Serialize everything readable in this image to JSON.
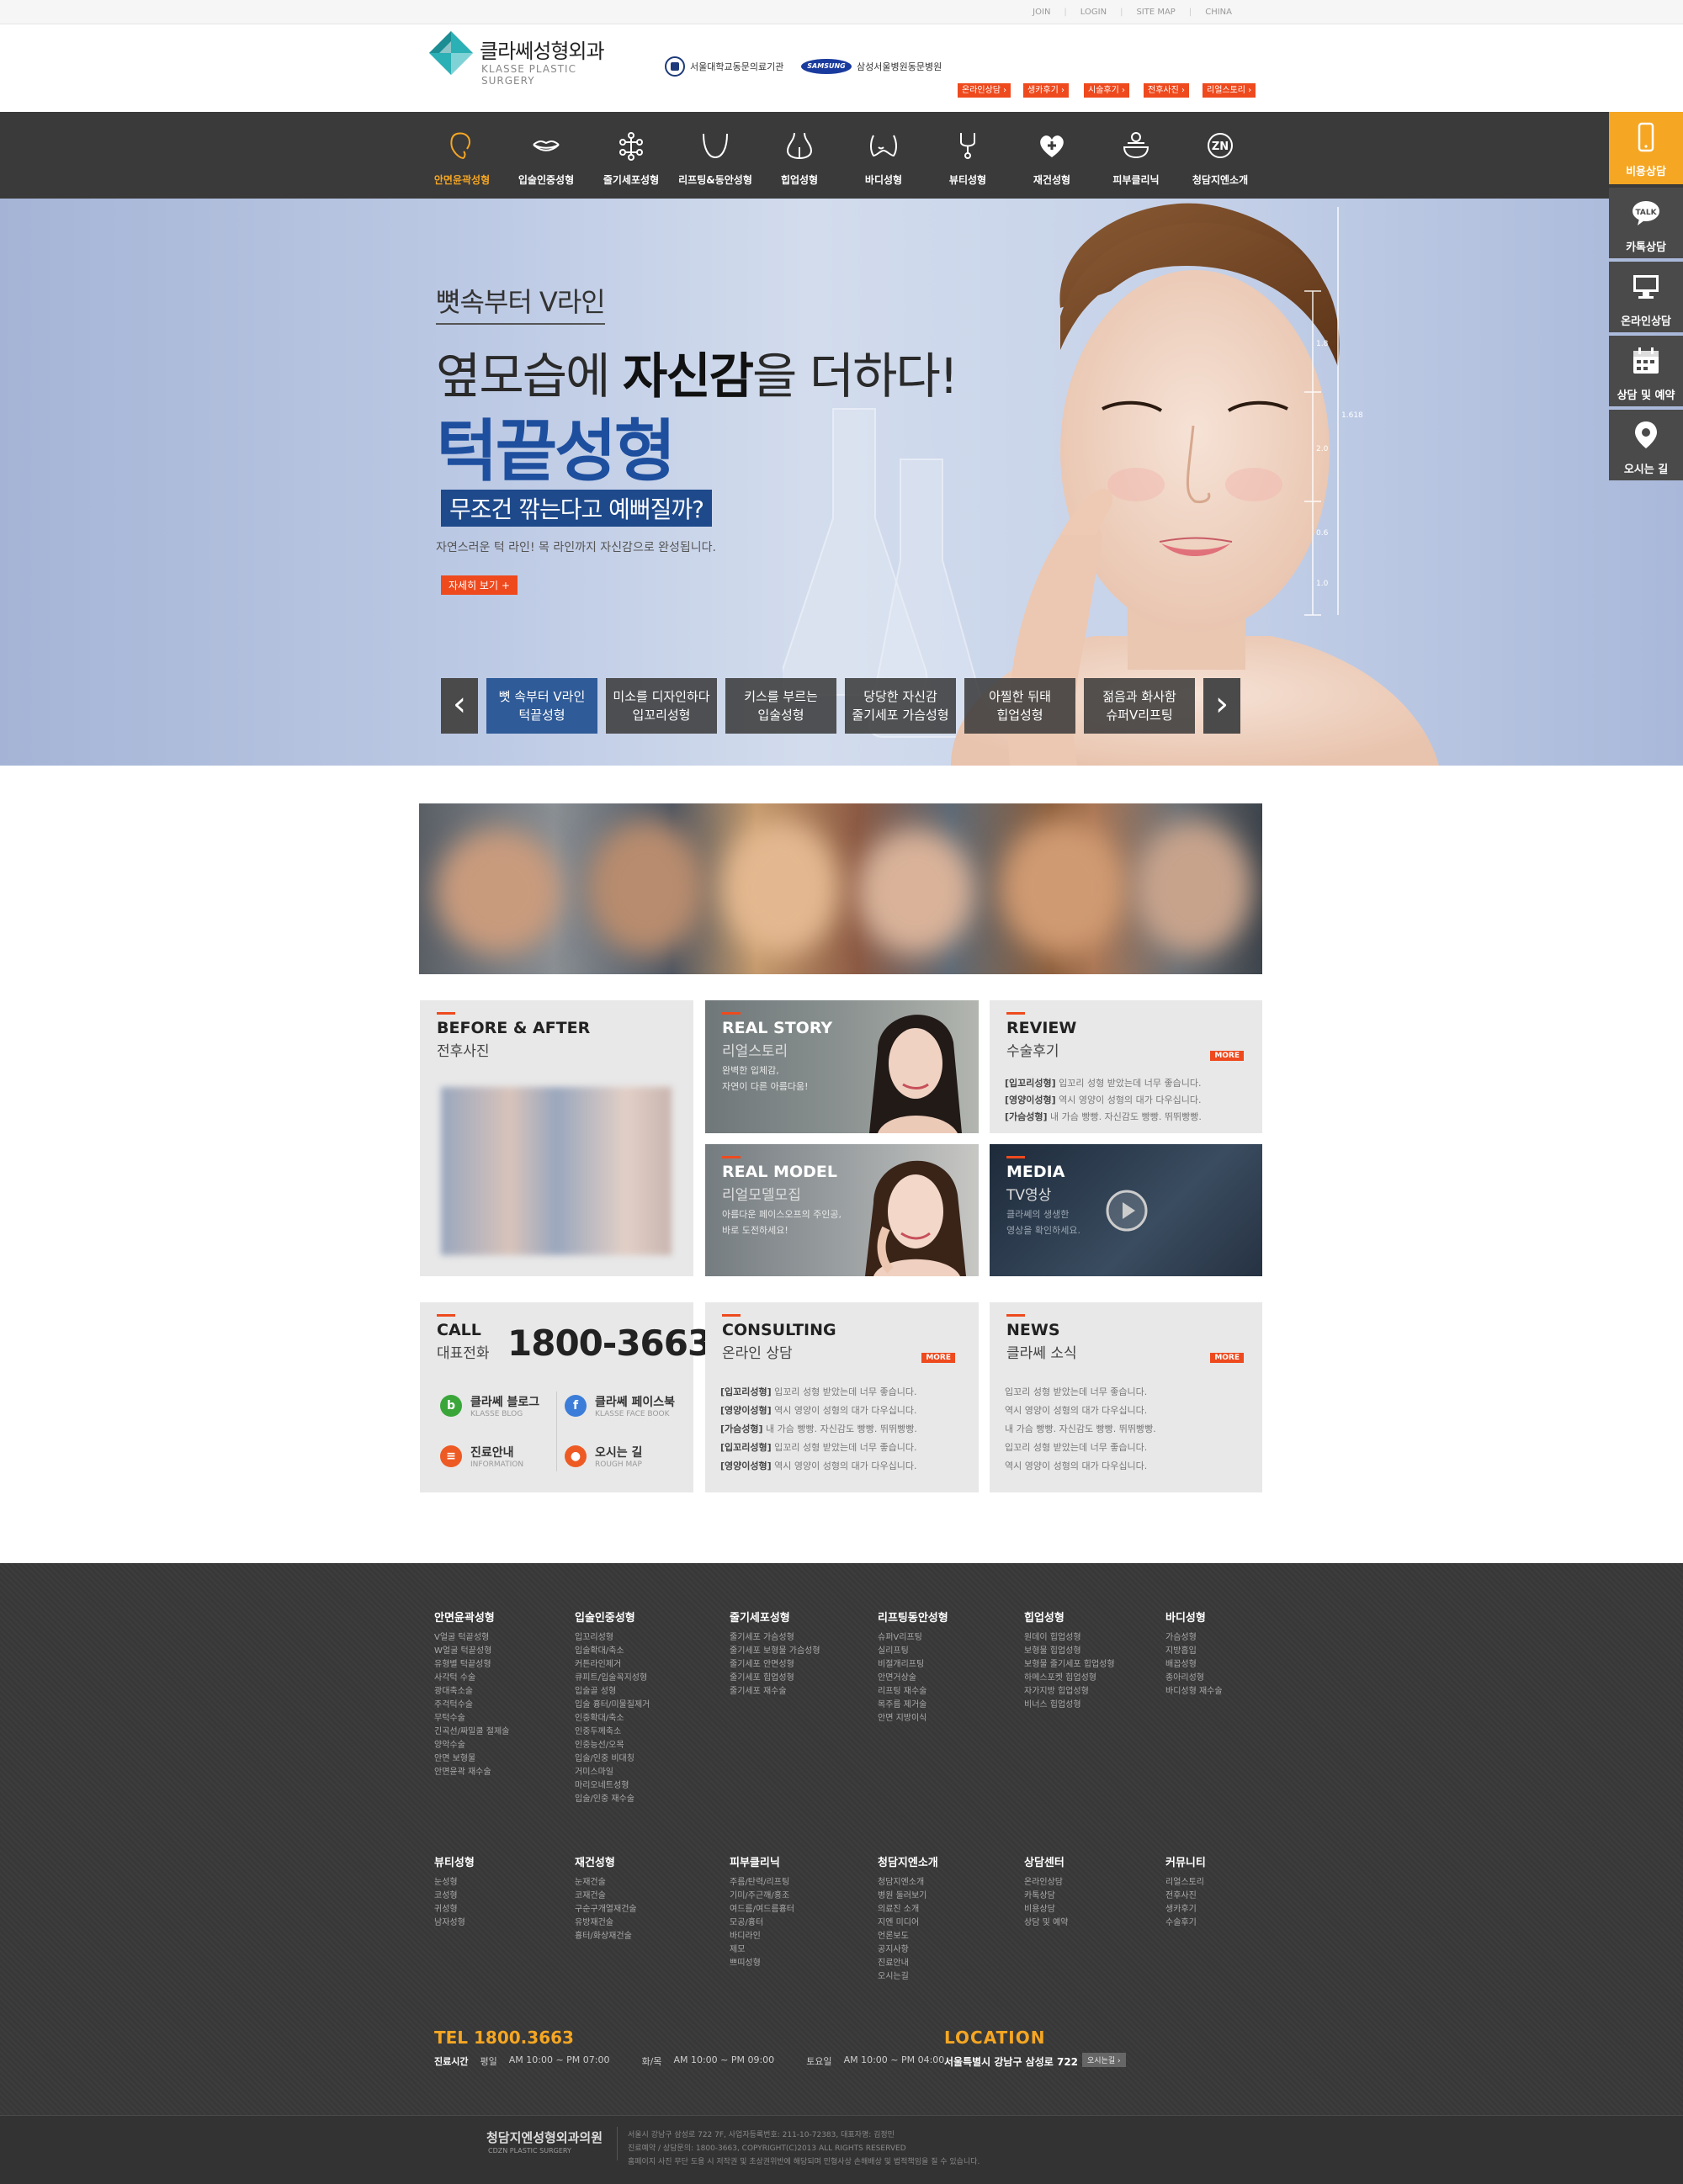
{
  "util": {
    "links": [
      "JOIN",
      "LOGIN",
      "SITE MAP",
      "CHINA"
    ]
  },
  "header": {
    "logo_ko": "클라쎄성형외과",
    "logo_en": "KLASSE PLASTIC SURGERY",
    "affil1": "서울대학교동문의료기관",
    "affil2_logo": "SAMSUNG",
    "affil2": "삼성서울병원동문병원",
    "buttons": [
      "온라인상담 ›",
      "생카후기 ›",
      "시술후기 ›",
      "전후사진 ›",
      "리얼스토리 ›"
    ]
  },
  "nav": [
    {
      "label": "안면윤곽성형",
      "icon": "face-contour-icon",
      "active": true
    },
    {
      "label": "입술인중성형",
      "icon": "lips-icon"
    },
    {
      "label": "줄기세포성형",
      "icon": "stem-cell-icon"
    },
    {
      "label": "리프팅&동안성형",
      "icon": "lifting-icon"
    },
    {
      "label": "힙업성형",
      "icon": "hip-icon"
    },
    {
      "label": "바디성형",
      "icon": "body-icon"
    },
    {
      "label": "뷰티성형",
      "icon": "beauty-icon"
    },
    {
      "label": "재건성형",
      "icon": "reconstruction-icon"
    },
    {
      "label": "피부클리닉",
      "icon": "skin-clinic-icon"
    },
    {
      "label": "청담지엔소개",
      "icon": "zn-icon"
    }
  ],
  "quick": [
    {
      "label": "비용상담",
      "icon": "phone-icon"
    },
    {
      "label": "카톡상담",
      "icon": "talk-icon"
    },
    {
      "label": "온라인상담",
      "icon": "monitor-icon"
    },
    {
      "label": "상담 및 예약",
      "icon": "calendar-icon"
    },
    {
      "label": "오시는 길",
      "icon": "map-pin-icon"
    }
  ],
  "hero": {
    "sub": "뼛속부터 V라인",
    "main_pre": "옆모습에 ",
    "main_bold": "자신감",
    "main_post": "을 더하다!",
    "title": "턱끝성형",
    "tag": "무조건 깎는다고 예뻐질까?",
    "desc": "자연스러운 턱 라인! 목 라인까지 자신감으로 완성됩니다.",
    "btn": "자세히 보기 +",
    "prev": "‹",
    "next": "›",
    "thumbs": [
      {
        "l1": "뼛 속부터 V라인",
        "l2": "턱끝성형"
      },
      {
        "l1": "미소를 디자인하다",
        "l2": "입꼬리성형"
      },
      {
        "l1": "키스를 부르는",
        "l2": "입술성형"
      },
      {
        "l1": "당당한 자신감",
        "l2": "줄기세포 가슴성형"
      },
      {
        "l1": "아찔한 뒤태",
        "l2": "힙업성형"
      },
      {
        "l1": "젊음과 화사함",
        "l2": "슈퍼V리프팅"
      }
    ],
    "ruler": [
      "1.8",
      "1.618",
      "2.0",
      "0.6",
      "1.0"
    ]
  },
  "boxes": {
    "before": {
      "t": "BEFORE & AFTER",
      "k": "전후사진"
    },
    "real": {
      "t": "REAL STORY",
      "k": "리얼스토리",
      "d1": "완벽한 입체감,",
      "d2": "자연이 다른 아름다움!"
    },
    "review": {
      "t": "REVIEW",
      "k": "수술후기",
      "more": "MORE",
      "rows": [
        {
          "tag": "[입꼬리성형]",
          "txt": " 입꼬리 성형 받았는데 너무 좋습니다."
        },
        {
          "tag": "[영양이성형]",
          "txt": " 역시 영양이 성형의 대가 다우십니다."
        },
        {
          "tag": "[가슴성형]",
          "txt": " 내 가슴 빵빵. 자신감도 빵빵. 뛰뛰빵빵."
        }
      ]
    },
    "model": {
      "t": "REAL MODEL",
      "k": "리얼모델모집",
      "d1": "아름다운 페이스오프의 주인공,",
      "d2": "바로 도전하세요!"
    },
    "media": {
      "t": "MEDIA",
      "k": "TV영상",
      "d1": "클라쎄의 생생한",
      "d2": "영상을 확인하세요."
    },
    "call": {
      "t": "CALL",
      "k": "대표전화",
      "tel": "1800-3663",
      "items": [
        {
          "t1": "클라쎄 블로그",
          "t2": "KLASSE BLOG",
          "ic": "b",
          "color": "#3aa63a",
          "icon": "blog-icon"
        },
        {
          "t1": "클라쎄 페이스북",
          "t2": "KLASSE FACE BOOK",
          "ic": "f",
          "color": "#3b7dd8",
          "icon": "facebook-icon"
        },
        {
          "t1": "진료안내",
          "t2": "INFORMATION",
          "ic": "≡",
          "color": "#ee5a24",
          "icon": "info-icon"
        },
        {
          "t1": "오시는 길",
          "t2": "ROUGH MAP",
          "ic": "●",
          "color": "#ee5a24",
          "icon": "map-icon"
        }
      ]
    },
    "consult": {
      "t": "CONSULTING",
      "k": "온라인 상담",
      "more": "MORE",
      "rows": [
        {
          "tag": "[입꼬리성형]",
          "txt": " 입꼬리 성형 받았는데 너무 좋습니다."
        },
        {
          "tag": "[영양이성형]",
          "txt": " 역시 영양이 성형의 대가 다우십니다."
        },
        {
          "tag": "[가슴성형]",
          "txt": " 내 가슴 빵빵. 자신감도 빵빵. 뛰뛰빵빵."
        },
        {
          "tag": "[입꼬리성형]",
          "txt": " 입꼬리 성형 받았는데 너무 좋습니다."
        },
        {
          "tag": "[영양이성형]",
          "txt": " 역시 영양이 성형의 대가 다우십니다."
        }
      ]
    },
    "news": {
      "t": "NEWS",
      "k": "클라쎄 소식",
      "more": "MORE",
      "rows": [
        "입꼬리 성형 받았는데 너무 좋습니다.",
        "역시 영양이 성형의 대가 다우십니다.",
        "내 가슴 빵빵. 자신감도 빵빵. 뛰뛰빵빵.",
        "입꼬리 성형 받았는데 너무 좋습니다.",
        "역시 영양이 성형의 대가 다우십니다."
      ]
    }
  },
  "footer": {
    "cols1": [
      {
        "h": "안면윤곽성형",
        "items": [
          "V얼굴 턱끝성형",
          "W얼굴 턱끝성형",
          "유형별 턱끝성형",
          "사각턱 수술",
          "광대축소술",
          "주걱턱수술",
          "무턱수술",
          "긴곡선/짜밀쿨 절제술",
          "양악수술",
          "안면 보형물",
          "안면윤곽 재수술"
        ]
      },
      {
        "h": "입술인중성형",
        "items": [
          "입꼬리성형",
          "입술확대/축소",
          "커튼라인제거",
          "큐피트/입술꼭지성형",
          "입술골 성형",
          "입술 흉터/미물질제거",
          "인중확대/축소",
          "인중두께축소",
          "인중능선/오목",
          "입술/인중 비대칭",
          "거미스마일",
          "마리오네트성형",
          "입술/인중 재수술"
        ]
      },
      {
        "h": "줄기세포성형",
        "items": [
          "줄기세포 가슴성형",
          "줄기세포 보형물 가슴성형",
          "줄기세포 안면성형",
          "줄기세포 힙업성형",
          "줄기세포 재수술"
        ]
      },
      {
        "h": "리프팅동안성형",
        "items": [
          "슈퍼V리프팅",
          "실리프팅",
          "비절개리프팅",
          "안면거상술",
          "리프팅 재수술",
          "목주름 제거술",
          "안면 지방이식"
        ]
      },
      {
        "h": "힙업성형",
        "items": [
          "원데이 힙업성형",
          "보형물 힙업성형",
          "보형물 줄기세포 힙업성형",
          "하메스포켓 힙업성형",
          "자가지방 힙업성형",
          "비너스 힙업성형"
        ]
      },
      {
        "h": "바디성형",
        "items": [
          "가슴성형",
          "지방흡입",
          "배꼽성형",
          "종아리성형",
          "바디성형 재수술"
        ]
      }
    ],
    "cols2": [
      {
        "h": "뷰티성형",
        "items": [
          "눈성형",
          "코성형",
          "귀성형",
          "남자성형"
        ]
      },
      {
        "h": "재건성형",
        "items": [
          "눈재건술",
          "코재건술",
          "구순구개열재건술",
          "유방재건술",
          "흉터/화상재건술"
        ]
      },
      {
        "h": "피부클리닉",
        "items": [
          "주름/탄력/리프팅",
          "기미/주근깨/홍조",
          "여드름/여드름흉터",
          "모공/흉터",
          "바디라인",
          "제모",
          "쁘띠성형"
        ]
      },
      {
        "h": "청담지엔소개",
        "items": [
          "청담지엔소개",
          "병원 둘러보기",
          "의료진 소개",
          "지엔 미디어",
          "언론보도",
          "공지사항",
          "진료안내",
          "오시는길"
        ]
      },
      {
        "h": "상담센터",
        "items": [
          "온라인상담",
          "카톡상담",
          "비용상담",
          "상담 및 예약"
        ]
      },
      {
        "h": "커뮤니티",
        "items": [
          "리얼스토리",
          "전후사진",
          "생카후기",
          "수술후기"
        ]
      }
    ],
    "tel": "TEL 1800.3663",
    "location": "LOCATION",
    "hours_label": "진료시간",
    "hours": [
      {
        "d": "평일",
        "t": "AM 10:00 ~ PM 07:00"
      },
      {
        "d": "화/목",
        "t": "AM 10:00 ~ PM 09:00"
      },
      {
        "d": "토요일",
        "t": "AM 10:00 ~ PM 04:00"
      }
    ],
    "address": "서울특별시 강남구 삼성로 722 7F",
    "map_btn": "오시는길 ›",
    "brand": "청담지엔성형외과의원",
    "brand_en": "CDZN PLASTIC SURGERY",
    "copy1": "서울시 강남구 삼성로 722 7F, 사업자등록번호: 211-10-72383, 대표자명: 김정민",
    "copy2": "진료예약 / 상담문의: 1800-3663, COPYRIGHT(C)2013 ALL RIGHTS RESERVED",
    "copy3": "홈페이지 사진 무단 도용 시 저작권 및 초상권위반에 해당되며 민형사상 손해배상 및 법적책임을 질 수 있습니다."
  },
  "colors": {
    "accent": "#ee4a1e",
    "nav_bg": "#3a3a3a",
    "active": "#f5a623",
    "hero_title": "#1e4f9e"
  }
}
